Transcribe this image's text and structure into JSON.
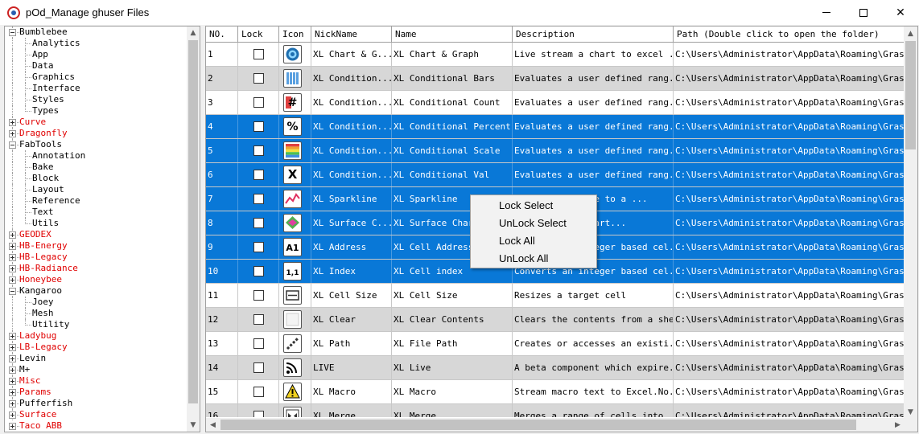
{
  "window": {
    "title": "pOd_Manage ghuser Files",
    "minimize_icon": "minimize-icon",
    "maximize_icon": "maximize-icon",
    "close_symbol": "✕"
  },
  "tree": {
    "items": [
      {
        "label": "Bumblebee",
        "level": 0,
        "expanded": true,
        "red": false
      },
      {
        "label": "Analytics",
        "level": 1
      },
      {
        "label": "App",
        "level": 1
      },
      {
        "label": "Data",
        "level": 1
      },
      {
        "label": "Graphics",
        "level": 1
      },
      {
        "label": "Interface",
        "level": 1
      },
      {
        "label": "Styles",
        "level": 1
      },
      {
        "label": "Types",
        "level": 1
      },
      {
        "label": "Curve",
        "level": 0,
        "expanded": false,
        "red": true
      },
      {
        "label": "Dragonfly",
        "level": 0,
        "expanded": false,
        "red": true
      },
      {
        "label": "FabTools",
        "level": 0,
        "expanded": true,
        "red": false
      },
      {
        "label": "Annotation",
        "level": 1
      },
      {
        "label": "Bake",
        "level": 1
      },
      {
        "label": "Block",
        "level": 1
      },
      {
        "label": "Layout",
        "level": 1
      },
      {
        "label": "Reference",
        "level": 1
      },
      {
        "label": "Text",
        "level": 1
      },
      {
        "label": "Utils",
        "level": 1
      },
      {
        "label": "GEODEX",
        "level": 0,
        "expanded": false,
        "red": true
      },
      {
        "label": "HB-Energy",
        "level": 0,
        "expanded": false,
        "red": true
      },
      {
        "label": "HB-Legacy",
        "level": 0,
        "expanded": false,
        "red": true
      },
      {
        "label": "HB-Radiance",
        "level": 0,
        "expanded": false,
        "red": true
      },
      {
        "label": "Honeybee",
        "level": 0,
        "expanded": false,
        "red": true
      },
      {
        "label": "Kangaroo",
        "level": 0,
        "expanded": true,
        "red": false
      },
      {
        "label": "Joey",
        "level": 1
      },
      {
        "label": "Mesh",
        "level": 1
      },
      {
        "label": "Utility",
        "level": 1
      },
      {
        "label": "Ladybug",
        "level": 0,
        "expanded": false,
        "red": true
      },
      {
        "label": "LB-Legacy",
        "level": 0,
        "expanded": false,
        "red": true
      },
      {
        "label": "Levin",
        "level": 0,
        "expanded": false,
        "red": false
      },
      {
        "label": "M+",
        "level": 0,
        "expanded": false,
        "red": false
      },
      {
        "label": "Misc",
        "level": 0,
        "expanded": false,
        "red": true
      },
      {
        "label": "Params",
        "level": 0,
        "expanded": false,
        "red": true
      },
      {
        "label": "Pufferfish",
        "level": 0,
        "expanded": false,
        "red": false
      },
      {
        "label": "Surface",
        "level": 0,
        "expanded": false,
        "red": true
      },
      {
        "label": "Taco ABB",
        "level": 0,
        "expanded": false,
        "red": true
      }
    ]
  },
  "grid": {
    "columns": [
      {
        "key": "no",
        "label": "NO."
      },
      {
        "key": "lock",
        "label": "Lock"
      },
      {
        "key": "icon",
        "label": "Icon"
      },
      {
        "key": "nick",
        "label": "NickName"
      },
      {
        "key": "name",
        "label": "Name"
      },
      {
        "key": "desc",
        "label": "Description"
      },
      {
        "key": "path",
        "label": "Path (Double click to open the folder)"
      }
    ],
    "rows": [
      {
        "no": "1",
        "locked": false,
        "icon": "chart-graph-icon",
        "nick": "XL Chart & G...",
        "name": "XL Chart & Graph",
        "desc": "Live stream a chart to excel ...",
        "path": "C:\\Users\\Administrator\\AppData\\Roaming\\Grassho...",
        "state": "white"
      },
      {
        "no": "2",
        "locked": false,
        "icon": "conditional-bars-icon",
        "nick": "XL Condition...",
        "name": "XL Conditional Bars",
        "desc": "Evaluates a user defined rang...",
        "path": "C:\\Users\\Administrator\\AppData\\Roaming\\Grassho...",
        "state": "gray"
      },
      {
        "no": "3",
        "locked": false,
        "icon": "conditional-count-icon",
        "nick": "XL Condition...",
        "name": "XL Conditional Count",
        "desc": "Evaluates a user defined rang...",
        "path": "C:\\Users\\Administrator\\AppData\\Roaming\\Grassho...",
        "state": "white"
      },
      {
        "no": "4",
        "locked": false,
        "icon": "conditional-percent-icon",
        "nick": "XL Condition...",
        "name": "XL Conditional Percent",
        "desc": "Evaluates a user defined rang...",
        "path": "C:\\Users\\Administrator\\AppData\\Roaming\\Grassho...",
        "state": "sel"
      },
      {
        "no": "5",
        "locked": false,
        "icon": "conditional-scale-icon",
        "nick": "XL Condition...",
        "name": "XL Conditional Scale",
        "desc": "Evaluates a user defined rang...",
        "path": "C:\\Users\\Administrator\\AppData\\Roaming\\Grassho...",
        "state": "sel"
      },
      {
        "no": "6",
        "locked": false,
        "icon": "conditional-val-icon",
        "nick": "XL Condition...",
        "name": "XL Conditional Val",
        "desc": "Evaluates a user defined rang...",
        "path": "C:\\Users\\Administrator\\AppData\\Roaming\\Grassho...",
        "state": "sel"
      },
      {
        "no": "7",
        "locked": false,
        "icon": "sparkline-icon",
        "nick": "XL Sparkline",
        "name": "XL Sparkline",
        "desc": "Adds a sparkline to a ...",
        "path": "C:\\Users\\Administrator\\AppData\\Roaming\\Grassho...",
        "state": "sel"
      },
      {
        "no": "8",
        "locked": false,
        "icon": "surface-chart-icon",
        "nick": "XL Surface C...",
        "name": "XL Surface Chart",
        "desc": "Adds a based chart...",
        "path": "C:\\Users\\Administrator\\AppData\\Roaming\\Grassho...",
        "state": "sel"
      },
      {
        "no": "9",
        "locked": false,
        "icon": "address-icon",
        "nick": "XL Address",
        "name": "XL Cell Address",
        "desc": "Converts an integer based cel...",
        "path": "C:\\Users\\Administrator\\AppData\\Roaming\\Grassho...",
        "state": "sel"
      },
      {
        "no": "10",
        "locked": false,
        "icon": "index-icon",
        "nick": "XL Index",
        "name": "XL Cell index",
        "desc": "Converts an integer based cel...",
        "path": "C:\\Users\\Administrator\\AppData\\Roaming\\Grassho...",
        "state": "sel"
      },
      {
        "no": "11",
        "locked": false,
        "icon": "cell-size-icon",
        "nick": "XL Cell Size",
        "name": "XL Cell Size",
        "desc": "Resizes a target cell",
        "path": "C:\\Users\\Administrator\\AppData\\Roaming\\Grassho...",
        "state": "white"
      },
      {
        "no": "12",
        "locked": false,
        "icon": "clear-icon",
        "nick": "XL Clear",
        "name": "XL Clear Contents",
        "desc": "Clears the contents from a sheet",
        "path": "C:\\Users\\Administrator\\AppData\\Roaming\\Grassho...",
        "state": "gray"
      },
      {
        "no": "13",
        "locked": false,
        "icon": "path-icon",
        "nick": "XL Path",
        "name": "XL File Path",
        "desc": "Creates or accesses an existi...",
        "path": "C:\\Users\\Administrator\\AppData\\Roaming\\Grassho...",
        "state": "white"
      },
      {
        "no": "14",
        "locked": false,
        "icon": "live-icon",
        "nick": "LIVE",
        "name": "XL Live",
        "desc": "A beta component which expire...",
        "path": "C:\\Users\\Administrator\\AppData\\Roaming\\Grassho...",
        "state": "gray"
      },
      {
        "no": "15",
        "locked": false,
        "icon": "macro-icon",
        "nick": "XL Macro",
        "name": "XL Macro",
        "desc": "Stream macro text to Excel.No...",
        "path": "C:\\Users\\Administrator\\AppData\\Roaming\\Grassho...",
        "state": "white"
      },
      {
        "no": "16",
        "locked": false,
        "icon": "merge-icon",
        "nick": "XL Merge",
        "name": "XL Merge",
        "desc": "Merges a range of cells into ...",
        "path": "C:\\Users\\Administrator\\AppData\\Roaming\\Grassho...",
        "state": "gray"
      }
    ]
  },
  "context_menu": {
    "items": [
      "Lock Select",
      "UnLock Select",
      "Lock All",
      "UnLock All"
    ]
  },
  "colors": {
    "selection": "#0978d7",
    "alt_row": "#d7d7d7",
    "tree_red": "#e00000"
  }
}
